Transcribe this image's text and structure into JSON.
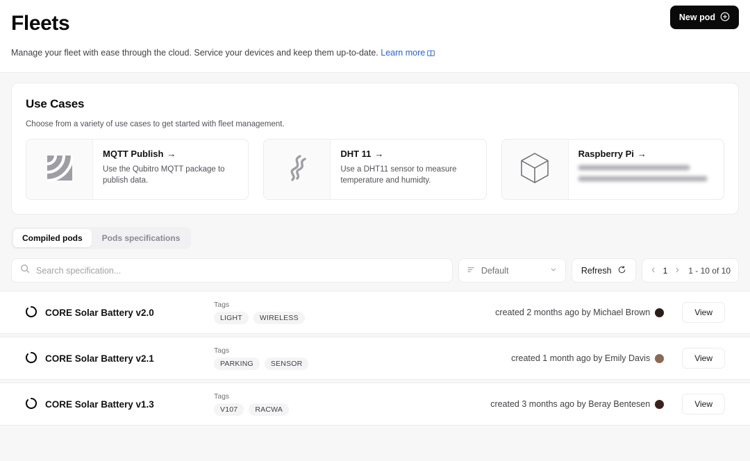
{
  "header": {
    "title": "Fleets",
    "subtitle": "Manage your fleet with ease through the cloud. Service your devices and keep them up-to-date.",
    "learn_more": "Learn more",
    "new_pod_label": "New pod"
  },
  "use_cases": {
    "title": "Use Cases",
    "subtitle": "Choose from a variety of use cases to get started with fleet management.",
    "items": [
      {
        "name": "MQTT Publish",
        "arrow": "→",
        "description": "Use the Qubitro MQTT package to publish data.",
        "icon": "rss-signal-icon",
        "redacted": false
      },
      {
        "name": "DHT 11",
        "arrow": "→",
        "description": "Use a DHT11 sensor to measure temperature and humidty.",
        "icon": "steam-wave-icon",
        "redacted": false
      },
      {
        "name": "Raspberry Pi",
        "arrow": "→",
        "description": "",
        "icon": "cube-icon",
        "redacted": true
      }
    ]
  },
  "tabs": [
    {
      "label": "Compiled pods",
      "active": true
    },
    {
      "label": "Pods specifications",
      "active": false
    }
  ],
  "toolbar": {
    "search_placeholder": "Search specification...",
    "search_value": "",
    "sort_value": "Default",
    "refresh_label": "Refresh",
    "page_number": "1",
    "page_range": "1 - 10 of 10"
  },
  "list": {
    "tags_label": "Tags",
    "view_label": "View",
    "rows": [
      {
        "name": "CORE Solar Battery v2.0",
        "tags": [
          "LIGHT",
          "WIRELESS"
        ],
        "meta": "created 2 months ago by Michael Brown",
        "avatar_color": "#2b1d17"
      },
      {
        "name": "CORE Solar Battery v2.1",
        "tags": [
          "PARKING",
          "SENSOR"
        ],
        "meta": "created 1 month ago by Emily Davis",
        "avatar_color": "#8a6a57"
      },
      {
        "name": "CORE Solar Battery v1.3",
        "tags": [
          "V107",
          "RACWA"
        ],
        "meta": "created 3 months ago by Beray Bentesen",
        "avatar_color": "#3a211b"
      }
    ]
  },
  "colors": {
    "accent_link": "#2563eb",
    "button_bg": "#0a0a0a",
    "page_bg": "#f7f7f8"
  }
}
